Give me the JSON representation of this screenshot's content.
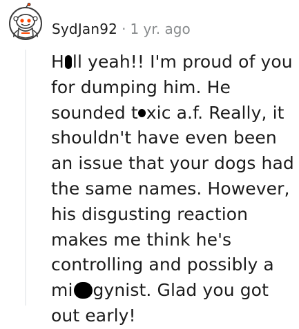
{
  "comment": {
    "username": "SydJan92",
    "separator": "·",
    "timestamp": "1 yr. ago",
    "avatar_icon": "snoo-avatar-icon",
    "body": {
      "part1": "H",
      "part2": "ll yeah!! I'm proud of you for dumping him. He sounded t",
      "part3": "xic a.f. Really, it shouldn't have even been an issue that your dogs had the same names. However, his disgusting reaction makes me think he's controlling and possibly a mi",
      "part4": "gynist. Glad you got out early!"
    }
  },
  "colors": {
    "text": "#1c1c1c",
    "meta": "#878a8c",
    "thread_line": "#edeff1",
    "redaction": "#000000",
    "avatar_accent": "#ff4500"
  }
}
